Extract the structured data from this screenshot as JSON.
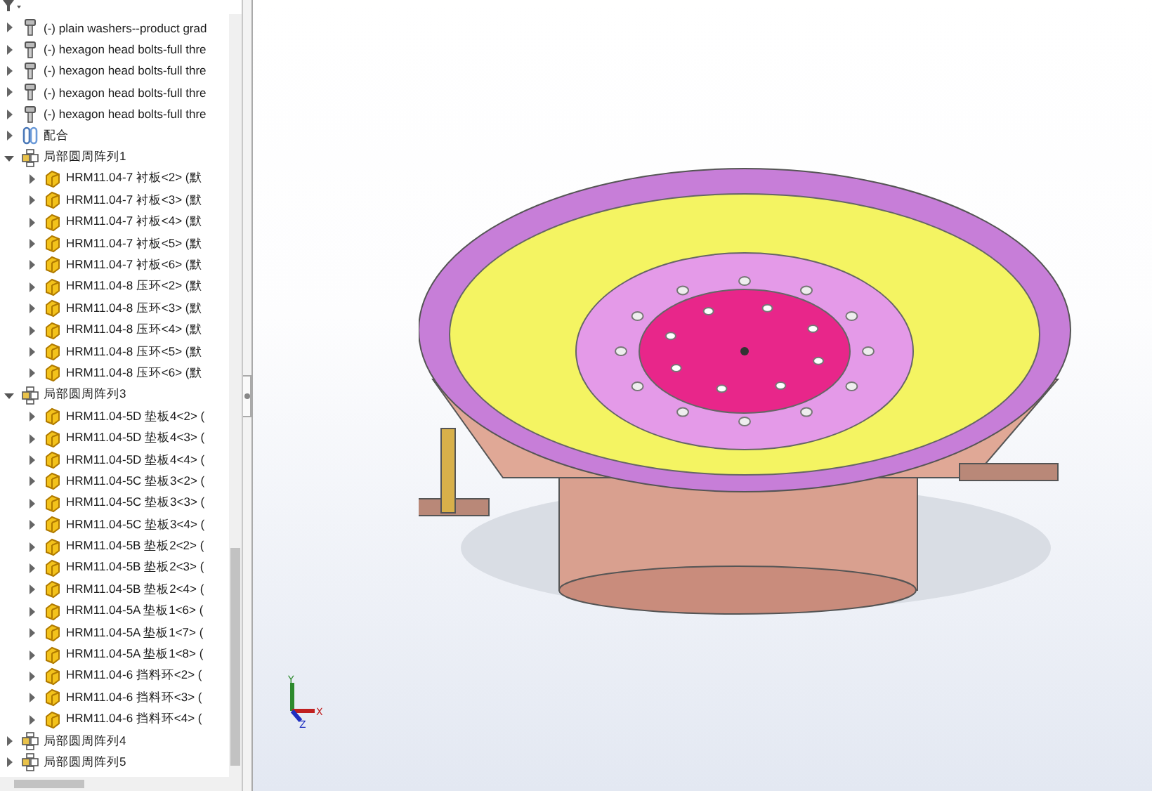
{
  "tree": {
    "items": [
      {
        "kind": "bolt",
        "label": "(-) plain washers--product grad",
        "expanded": false
      },
      {
        "kind": "bolt",
        "label": "(-) hexagon head bolts-full thre",
        "expanded": false
      },
      {
        "kind": "bolt",
        "label": "(-) hexagon head bolts-full thre",
        "expanded": false
      },
      {
        "kind": "bolt",
        "label": "(-) hexagon head bolts-full thre",
        "expanded": false
      },
      {
        "kind": "bolt",
        "label": "(-) hexagon head bolts-full thre",
        "expanded": false
      },
      {
        "kind": "mate",
        "label": "配合",
        "expanded": false
      },
      {
        "kind": "pattern",
        "label": "局部圆周阵列1",
        "expanded": true,
        "children": [
          {
            "kind": "part",
            "label": "HRM11.04-7 衬板<2> (默",
            "expanded": false
          },
          {
            "kind": "part",
            "label": "HRM11.04-7 衬板<3> (默",
            "expanded": false
          },
          {
            "kind": "part",
            "label": "HRM11.04-7 衬板<4> (默",
            "expanded": false
          },
          {
            "kind": "part",
            "label": "HRM11.04-7 衬板<5> (默",
            "expanded": false
          },
          {
            "kind": "part",
            "label": "HRM11.04-7 衬板<6> (默",
            "expanded": false
          },
          {
            "kind": "part",
            "label": "HRM11.04-8 压环<2> (默",
            "expanded": false
          },
          {
            "kind": "part",
            "label": "HRM11.04-8 压环<3> (默",
            "expanded": false
          },
          {
            "kind": "part",
            "label": "HRM11.04-8 压环<4> (默",
            "expanded": false
          },
          {
            "kind": "part",
            "label": "HRM11.04-8 压环<5> (默",
            "expanded": false
          },
          {
            "kind": "part",
            "label": "HRM11.04-8 压环<6> (默",
            "expanded": false
          }
        ]
      },
      {
        "kind": "pattern",
        "label": "局部圆周阵列3",
        "expanded": true,
        "children": [
          {
            "kind": "part",
            "label": "HRM11.04-5D 垫板4<2> (",
            "expanded": false
          },
          {
            "kind": "part",
            "label": "HRM11.04-5D 垫板4<3> (",
            "expanded": false
          },
          {
            "kind": "part",
            "label": "HRM11.04-5D 垫板4<4> (",
            "expanded": false
          },
          {
            "kind": "part",
            "label": "HRM11.04-5C 垫板3<2> (",
            "expanded": false
          },
          {
            "kind": "part",
            "label": "HRM11.04-5C 垫板3<3> (",
            "expanded": false
          },
          {
            "kind": "part",
            "label": "HRM11.04-5C 垫板3<4> (",
            "expanded": false
          },
          {
            "kind": "part",
            "label": "HRM11.04-5B 垫板2<2> (",
            "expanded": false
          },
          {
            "kind": "part",
            "label": "HRM11.04-5B 垫板2<3> (",
            "expanded": false
          },
          {
            "kind": "part",
            "label": "HRM11.04-5B 垫板2<4> (",
            "expanded": false
          },
          {
            "kind": "part",
            "label": "HRM11.04-5A 垫板1<6> (",
            "expanded": false
          },
          {
            "kind": "part",
            "label": "HRM11.04-5A 垫板1<7> (",
            "expanded": false
          },
          {
            "kind": "part",
            "label": "HRM11.04-5A 垫板1<8> (",
            "expanded": false
          },
          {
            "kind": "part",
            "label": "HRM11.04-6 挡料环<2> (",
            "expanded": false
          },
          {
            "kind": "part",
            "label": "HRM11.04-6 挡料环<3> (",
            "expanded": false
          },
          {
            "kind": "part",
            "label": "HRM11.04-6 挡料环<4> (",
            "expanded": false
          }
        ]
      },
      {
        "kind": "pattern",
        "label": "局部圆周阵列4",
        "expanded": false
      },
      {
        "kind": "pattern",
        "label": "局部圆周阵列5",
        "expanded": false
      }
    ]
  },
  "triad": {
    "labels": [
      "Y",
      "X",
      "Z"
    ]
  }
}
